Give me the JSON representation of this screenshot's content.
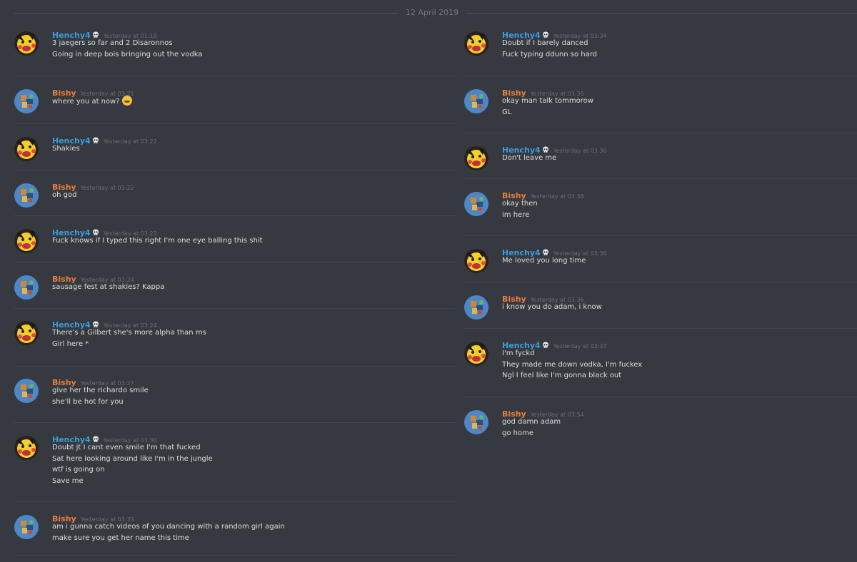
{
  "date_divider": "12 April 2019",
  "icons": {
    "avatar_henchy": "pikachu-avatar-icon",
    "avatar_bishy": "blue-game-avatar-icon",
    "badge": "skull-icon",
    "emoji": "grinning-emoji-icon"
  },
  "colors": {
    "background": "#36393f",
    "henchy": "#3b9ddd",
    "bishy": "#e67e3c",
    "text": "#dcddde",
    "timestamp": "#6a6e75"
  },
  "left_messages": [
    {
      "author": "Henchy4",
      "time": "Yesterday at 01:18",
      "lines": [
        "3 jaegers so far and 2 Disaronnos",
        "Going in deep bois bringing out the vodka"
      ]
    },
    {
      "author": "Bishy",
      "time": "Yesterday at 03:21",
      "lines": [
        "where you at now?"
      ]
    },
    {
      "author": "Henchy4",
      "time": "Yesterday at 03:22",
      "lines": [
        "Shakies"
      ]
    },
    {
      "author": "Bishy",
      "time": "Yesterday at 03:22",
      "lines": [
        "oh god"
      ]
    },
    {
      "author": "Henchy4",
      "time": "Yesterday at 03:23",
      "lines": [
        "Fuck knows if I typed this right I'm one eye balling this shit"
      ]
    },
    {
      "author": "Bishy",
      "time": "Yesterday at 03:24",
      "lines": [
        "sausage fest at shakies? Kappa"
      ]
    },
    {
      "author": "Henchy4",
      "time": "Yesterday at 03:24",
      "lines": [
        "There's a Gilbert she's more alpha than ms",
        "Girl here *"
      ]
    },
    {
      "author": "Bishy",
      "time": "Yesterday at 03:27",
      "lines": [
        "give her the richardo smile",
        "she'll be hot for you"
      ]
    },
    {
      "author": "Henchy4",
      "time": "Yesterday at 03:30",
      "lines": [
        "Doubt jt I cant even smile I'm that fucked",
        "Sat here looking around like I'm in the jungle",
        "wtf is going on",
        "Save me"
      ]
    },
    {
      "author": "Bishy",
      "time": "Yesterday at 03:33",
      "lines": [
        "am i gunna catch videos of you dancing with a random girl again",
        "make sure you get her name this time"
      ]
    }
  ],
  "right_messages": [
    {
      "author": "Henchy4",
      "time": "Yesterday at 03:34",
      "lines": [
        "Doubt if I barely danced",
        "Fuck typing ddunn so hard"
      ]
    },
    {
      "author": "Bishy",
      "time": "Yesterday at 03:35",
      "lines": [
        "okay man talk tommorow",
        "GL"
      ]
    },
    {
      "author": "Henchy4",
      "time": "Yesterday at 03:36",
      "lines": [
        "Don't leave me"
      ]
    },
    {
      "author": "Bishy",
      "time": "Yesterday at 03:36",
      "lines": [
        "okay then",
        "im here"
      ]
    },
    {
      "author": "Henchy4",
      "time": "Yesterday at 03:36",
      "lines": [
        "Me loved you long time"
      ]
    },
    {
      "author": "Bishy",
      "time": "Yesterday at 03:36",
      "lines": [
        "i know you do adam, i know"
      ]
    },
    {
      "author": "Henchy4",
      "time": "Yesterday at 03:37",
      "lines": [
        "I'm fyckd",
        "They made me down vodka, I'm fuckex",
        "Ngl I feel like  I'm gonna black out"
      ]
    },
    {
      "author": "Bishy",
      "time": "Yesterday at 03:54",
      "lines": [
        "god damn adam",
        "go home"
      ]
    }
  ]
}
